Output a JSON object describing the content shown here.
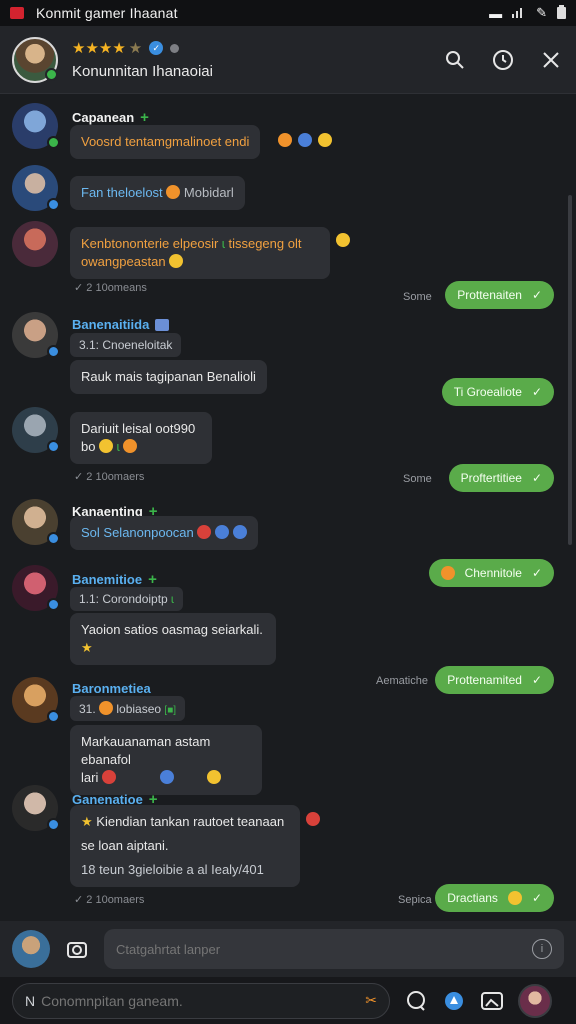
{
  "statusbar": {
    "title": "Konmit gamer Ihaanat",
    "icons": [
      "minus-icon",
      "signal-icon",
      "edit-icon",
      "battery-icon"
    ]
  },
  "header": {
    "stars": "★★★★",
    "dim_star": "★",
    "title": "Konunnitan Ihanaoiai",
    "actions": [
      "search-icon",
      "history-icon",
      "close-icon"
    ]
  },
  "messages": [
    {
      "sender": "Capanean",
      "text": "Voosrd tentamgmalinoet endi"
    },
    {
      "text_a": "Fan theloelost",
      "text_b": "Mobidarl"
    },
    {
      "line1": "Kenbtononterie elpeosir",
      "line1_b": "tissegeng olt",
      "line2": "owangpeastan",
      "meta": "2 10omeans"
    },
    {
      "sender": "Banenaitiida",
      "sub": "3.1: Cnoeneloitak",
      "text": "Rauk mais tagipanan Benalioli"
    },
    {
      "line1": "Dariuit leisal oot990",
      "line2": "bo",
      "meta": "2 10omaers"
    },
    {
      "sender": "Kanaenting",
      "text": "Sol Selanonpoocan"
    },
    {
      "sender": "Banemitioe",
      "sub": "1.1: Corondoiptp",
      "text": "Yaoion satios oasmag seiarkali."
    },
    {
      "sender": "Baronmetiea",
      "sub": "31.",
      "sub_b": "lobiaseo",
      "line1": "Markauanaman astam ebanafol",
      "line2": "lari"
    },
    {
      "sender": "Ganenatioe",
      "line1": "Kiendian tankan rautoet teanaan",
      "line2": "se loan aiptani.",
      "line3": "18 teun 3gieloibie a al Iealy/401",
      "meta": "2 10omaers"
    }
  ],
  "outgoing": [
    {
      "time": "Some",
      "text": "Prottenaiten"
    },
    {
      "time": "",
      "text": "Ti Groealiote"
    },
    {
      "time": "Some",
      "text": "Proftertitiee"
    },
    {
      "time": "",
      "text": "Chennitole"
    },
    {
      "time": "Aematiche",
      "text": "Prottenamited"
    },
    {
      "time": "Sepica",
      "text": "Dractians"
    }
  ],
  "composer": {
    "placeholder": "Ctatgahrtat lanper"
  },
  "bottombar": {
    "placeholder": "Conomnpitan ganeam."
  }
}
